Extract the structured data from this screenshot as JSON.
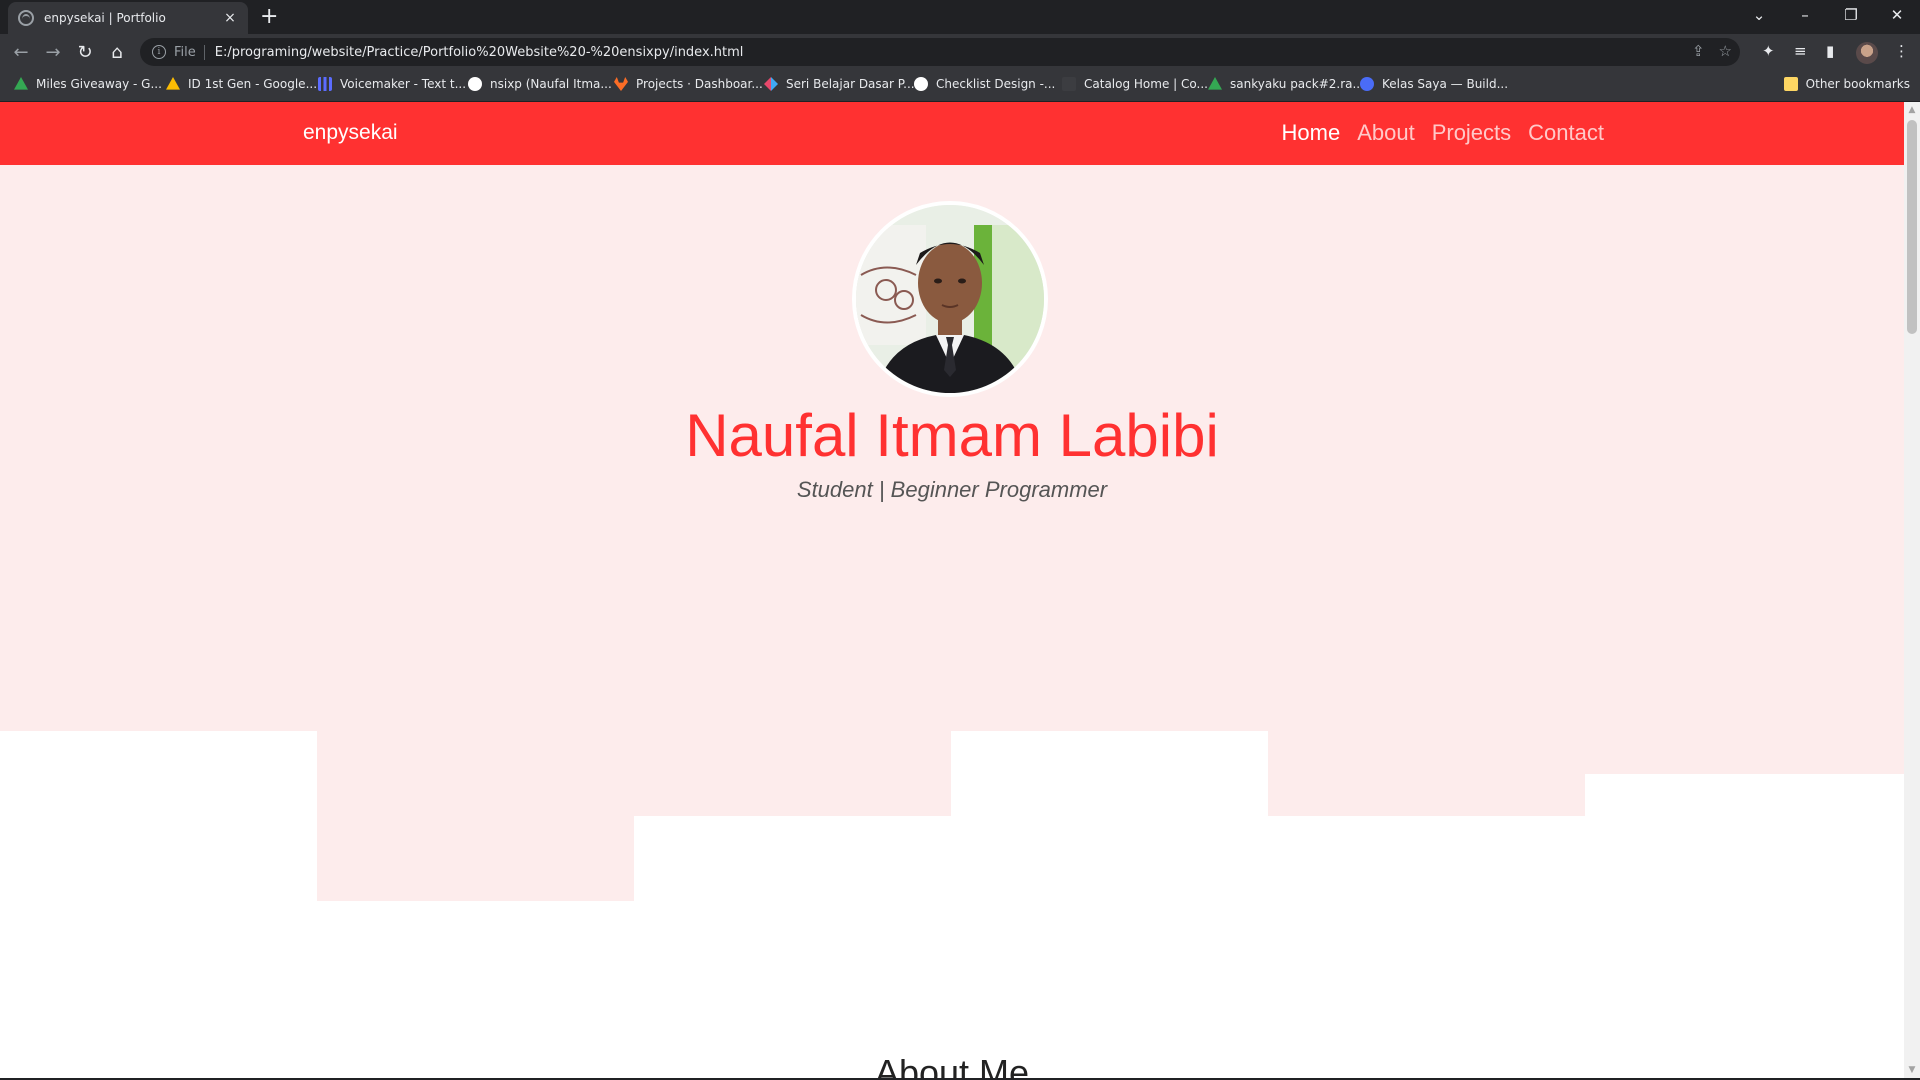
{
  "browser": {
    "tab_title": "enpysekai | Portfolio",
    "tab_close": "×",
    "new_tab": "+",
    "window_controls": {
      "tab_search": "⌄",
      "minimize": "–",
      "restore": "❐",
      "close": "✕"
    },
    "nav": {
      "back": "←",
      "forward": "→",
      "reload": "↻",
      "home": "⌂"
    },
    "omnibox": {
      "info_icon": "i",
      "scheme_label": "File",
      "url": "E:/programing/website/Practice/Portfolio%20Website%20-%20ensixpy/index.html",
      "share": "⇪",
      "bookmark_star": "☆"
    },
    "toolbar_icons": {
      "extensions": "✦",
      "media": "≡",
      "side_panel": "▮",
      "menu": "⋮"
    },
    "bookmarks": [
      {
        "label": "Miles Giveaway - G...",
        "icon": "drive-icon",
        "color": "#34a853"
      },
      {
        "label": "ID 1st Gen - Google...",
        "icon": "drive-icon",
        "color": "#fbbc04"
      },
      {
        "label": "Voicemaker - Text t...",
        "icon": "voicemaker-icon",
        "color": "#5b6cff"
      },
      {
        "label": "nsixp (Naufal Itma...",
        "icon": "github-icon",
        "color": "#ffffff"
      },
      {
        "label": "Projects · Dashboar...",
        "icon": "gitlab-icon",
        "color": "#fc6d26"
      },
      {
        "label": "Seri Belajar Dasar P...",
        "icon": "dicoding-icon",
        "color": "#e8486b"
      },
      {
        "label": "Checklist Design -...",
        "icon": "check-icon",
        "color": "#ffffff"
      },
      {
        "label": "Catalog Home | Co...",
        "icon": "catalog-icon",
        "color": "#35363a"
      },
      {
        "label": "sankyaku pack#2.ra...",
        "icon": "drive-icon",
        "color": "#34a853"
      },
      {
        "label": "Kelas Saya — Build...",
        "icon": "build-icon",
        "color": "#4a6cf7"
      }
    ],
    "other_bookmarks": "Other bookmarks",
    "other_bookmarks_color": "#fdd663"
  },
  "site": {
    "accent": "#ff3131",
    "hero_bg": "#fdecec",
    "brand": "enpysekai",
    "nav": [
      {
        "label": "Home",
        "active": true
      },
      {
        "label": "About",
        "active": false
      },
      {
        "label": "Projects",
        "active": false
      },
      {
        "label": "Contact",
        "active": false
      }
    ],
    "hero": {
      "name": "Naufal Itmam Labibi",
      "subtitle": "Student | Beginner Programmer"
    },
    "about_title": "About Me"
  },
  "scrollbar": {
    "up": "▲",
    "down": "▼"
  }
}
